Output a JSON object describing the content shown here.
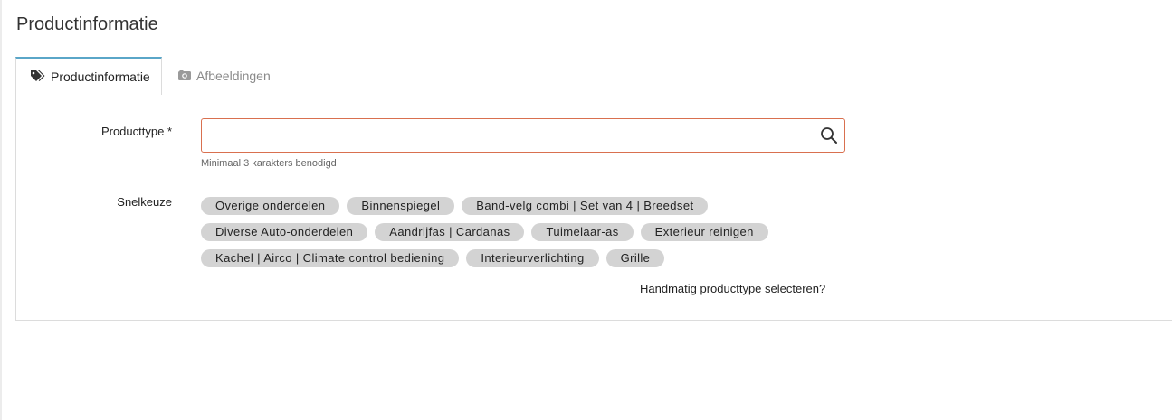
{
  "page": {
    "title": "Productinformatie"
  },
  "tabs": [
    {
      "label": "Productinformatie",
      "icon": "tags-icon",
      "active": true
    },
    {
      "label": "Afbeeldingen",
      "icon": "camera-icon",
      "active": false
    }
  ],
  "form": {
    "producttype_label": "Producttype *",
    "producttype_value": "",
    "producttype_placeholder": "",
    "hint": "Minimaal 3 karakters benodigd",
    "quick_label": "Snelkeuze",
    "quick_rows": [
      [
        "Overige onderdelen",
        "Binnenspiegel",
        "Band-velg combi | Set van 4 | Breedset"
      ],
      [
        "Diverse Auto-onderdelen",
        "Aandrijfas | Cardanas",
        "Tuimelaar-as",
        "Exterieur reinigen"
      ],
      [
        "Kachel | Airco | Climate control bediening",
        "Interieurverlichting",
        "Grille"
      ]
    ],
    "manual_link": "Handmatig producttype selecteren?"
  },
  "colors": {
    "input_border": "#d9704f",
    "tab_accent": "#5aa6c8",
    "chip_bg": "#d3d3d3"
  }
}
